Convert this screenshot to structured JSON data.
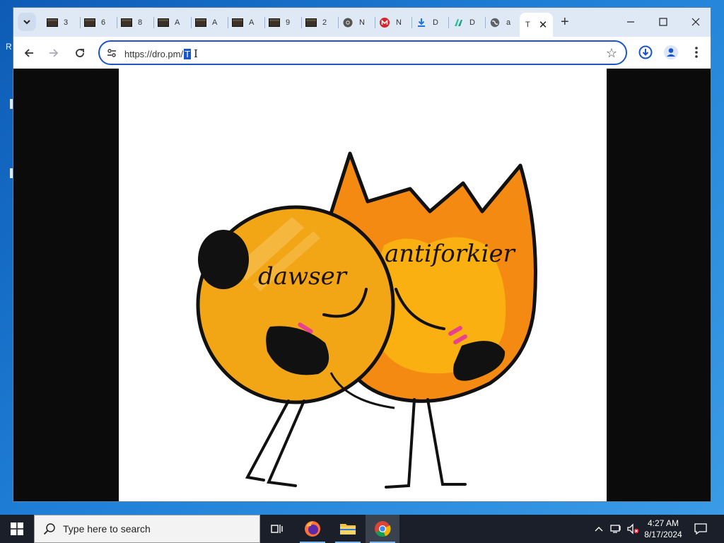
{
  "desktop": {
    "edge_text": "R"
  },
  "browser": {
    "tabs": [
      {
        "title": "3",
        "icon": "dark-thumbnail-favicon"
      },
      {
        "title": "6",
        "icon": "dark-thumbnail-favicon"
      },
      {
        "title": "8",
        "icon": "dark-thumbnail-favicon"
      },
      {
        "title": "A",
        "icon": "dark-thumbnail-favicon"
      },
      {
        "title": "A",
        "icon": "dark-thumbnail-favicon"
      },
      {
        "title": "A",
        "icon": "dark-thumbnail-favicon"
      },
      {
        "title": "9",
        "icon": "dark-thumbnail-favicon"
      },
      {
        "title": "2",
        "icon": "dark-thumbnail-favicon"
      },
      {
        "title": "N",
        "icon": "chrome-favicon"
      },
      {
        "title": "N",
        "icon": "red-m-favicon"
      },
      {
        "title": "D",
        "icon": "download-favicon"
      },
      {
        "title": "D",
        "icon": "green-d-favicon"
      },
      {
        "title": "a",
        "icon": "globe-favicon"
      }
    ],
    "active_tab": {
      "title": "T"
    },
    "omnibox": {
      "url_text": "https://dro.pm/",
      "selected_text": "T"
    }
  },
  "content": {
    "image_labels": {
      "left_character": "dawser",
      "right_character": "antiforkier"
    }
  },
  "taskbar": {
    "search_placeholder": "Type here to search",
    "apps": [
      "task-view",
      "firefox",
      "file-explorer",
      "chrome"
    ],
    "clock": {
      "time": "4:27 AM",
      "date": "8/17/2024"
    }
  },
  "colors": {
    "accent": "#1a56c8",
    "tabstrip": "#dfe8f5",
    "taskbar": "#1a1f29",
    "fire_orange": "#f48a12",
    "fire_yellow": "#fbb012",
    "ball_orange": "#f2a616"
  }
}
